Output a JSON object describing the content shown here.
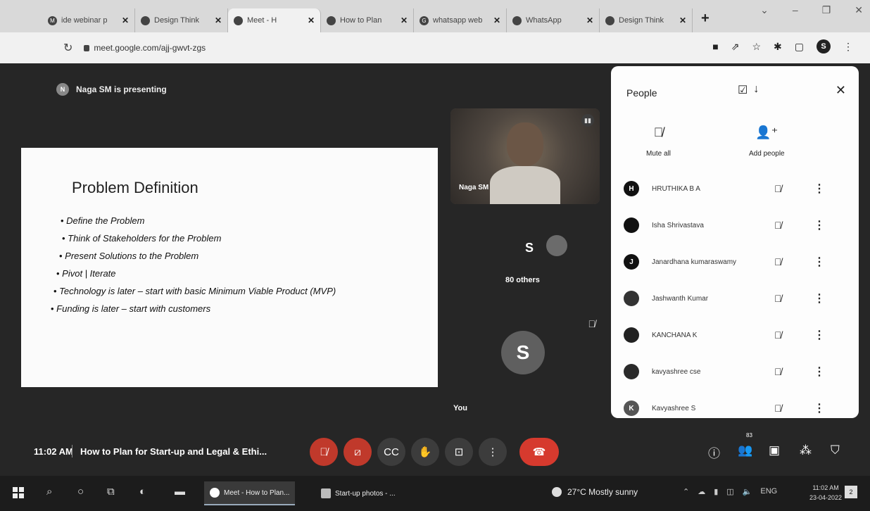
{
  "browser": {
    "tabs": [
      {
        "label": "ide webinar p",
        "icon": "gmail-icon"
      },
      {
        "label": "Design Think",
        "icon": "design-icon"
      },
      {
        "label": "Meet - H",
        "icon": "meet-icon"
      },
      {
        "label": "How to Plan",
        "icon": "slides-icon"
      },
      {
        "label": "whatsapp web",
        "icon": "google-icon"
      },
      {
        "label": "WhatsApp",
        "icon": "whatsapp-icon"
      },
      {
        "label": "Design Think",
        "icon": "design-icon"
      }
    ],
    "new_tab": "+",
    "url": "meet.google.com/ajj-gwvt-zgs"
  },
  "meet": {
    "presenter_initial": "N",
    "presenter_text": "Naga SM is presenting",
    "slide": {
      "title": "Problem Definition",
      "bullets": [
        "Define the Problem",
        "Think of Stakeholders for the Problem",
        "Present Solutions to the Problem",
        "Pivot | Iterate",
        "Technology is later – start with basic Minimum Viable Product (MVP)",
        "Funding is later – start with customers"
      ]
    },
    "speaker_tile_name": "Naga SM",
    "others_letter": "S",
    "others_count": "80 others",
    "you_initial": "S",
    "you_label": "You"
  },
  "people_panel": {
    "title": "People",
    "mute_all": "Mute all",
    "add_people": "Add people",
    "participants": [
      {
        "initial": "H",
        "name": "HRUTHIKA B A"
      },
      {
        "initial": "",
        "name": "Isha Shrivastava"
      },
      {
        "initial": "J",
        "name": "Janardhana kumaraswamy"
      },
      {
        "initial": "",
        "name": "Jashwanth Kumar"
      },
      {
        "initial": "",
        "name": "KANCHANA K"
      },
      {
        "initial": "",
        "name": "kavyashree cse"
      },
      {
        "initial": "K",
        "name": "Kavyashree S"
      }
    ]
  },
  "controls": {
    "time": "11:02 AM",
    "meeting_title": "How to Plan for Start-up and Legal & Ethi...",
    "participant_badge": "83"
  },
  "taskbar": {
    "apps": [
      {
        "label": "Meet - How to Plan..."
      },
      {
        "label": "Start-up photos - ..."
      }
    ],
    "weather": "27°C  Mostly sunny",
    "lang": "ENG",
    "time": "11:02 AM",
    "date": "23-04-2022",
    "notification_count": "2"
  }
}
